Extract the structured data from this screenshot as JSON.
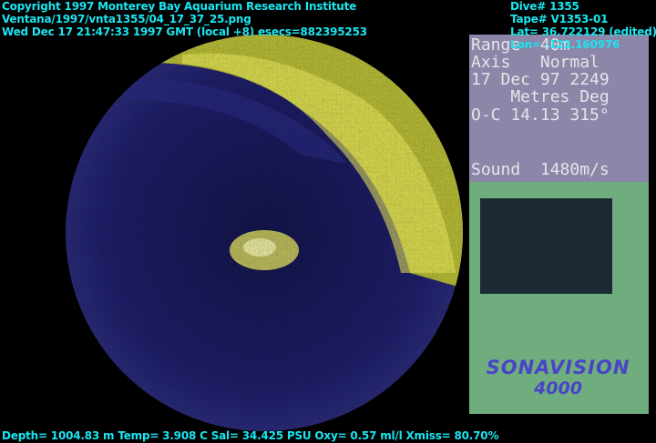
{
  "header": {
    "line1": "Copyright 1997 Monterey Bay Aquarium Research Institute",
    "line2": "Ventana/1997/vnta1355/04_17_37_25.png",
    "line3": "Wed Dec 17 21:47:33 1997 GMT (local +8)  esecs=882395253"
  },
  "dive": {
    "dive": "Dive# 1355",
    "tape": "Tape# V1353-01",
    "lat": "Lat= 36.722129 (edited)",
    "lon": "Lon= -122.160976"
  },
  "sonar_panel": {
    "range": "Range  40m",
    "axis": "Axis   Normal",
    "date": "17 Dec 97 2249",
    "units": "    Metres Deg",
    "oc": "O-C 14.13 315°",
    "sound": "Sound  1480m/s"
  },
  "logo": {
    "name": "SONAVISION",
    "model": "4000"
  },
  "footer": "Depth= 1004.83 m  Temp= 3.908 C  Sal= 34.425 PSU  Oxy= 0.57 ml/l  Xmiss= 80.70%"
}
